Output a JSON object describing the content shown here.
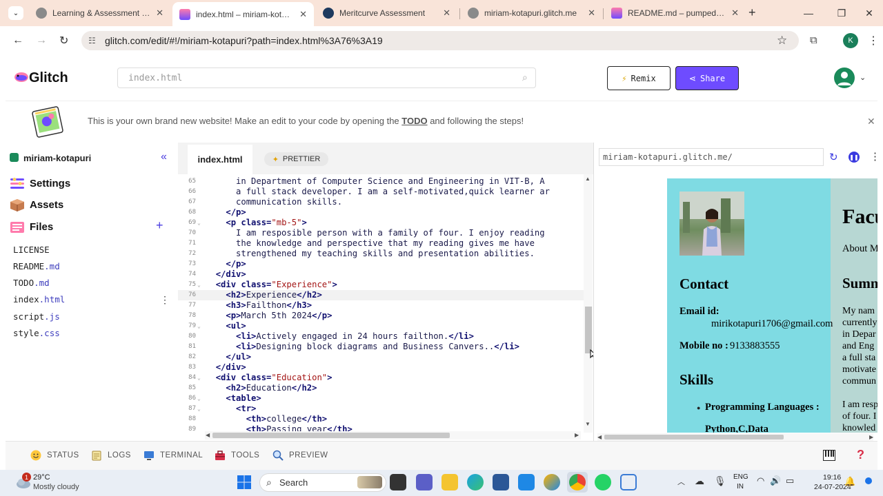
{
  "browser": {
    "tabs": [
      {
        "title": "Learning & Assessment Platform",
        "active": false
      },
      {
        "title": "index.html – miriam-kotapuri",
        "active": true
      },
      {
        "title": "Meritcurve Assessment",
        "active": false
      },
      {
        "title": "miriam-kotapuri.glitch.me",
        "active": false
      },
      {
        "title": "README.md – pumped-uneven",
        "active": false
      }
    ],
    "url": "glitch.com/edit/#!/miriam-kotapuri?path=index.html%3A76%3A19",
    "profile_initial": "K"
  },
  "glitch": {
    "logo": "Glitch",
    "search_placeholder": "index.html",
    "remix_label": "Remix",
    "share_label": "Share",
    "banner": {
      "before": "This is your own brand new website! Make an edit to your code by opening the ",
      "link": "TODO",
      "after": " and following the steps!"
    }
  },
  "sidebar": {
    "project_name": "miriam-kotapuri",
    "settings": "Settings",
    "assets": "Assets",
    "files_label": "Files",
    "files": [
      {
        "name": "LICENSE",
        "ext": ""
      },
      {
        "name": "README",
        "ext": ".md"
      },
      {
        "name": "TODO",
        "ext": ".md"
      },
      {
        "name": "index",
        "ext": ".html"
      },
      {
        "name": "script",
        "ext": ".js"
      },
      {
        "name": "style",
        "ext": ".css"
      }
    ]
  },
  "editor": {
    "active_file": "index.html",
    "prettier": "PRETTIER",
    "lines": [
      {
        "n": "65",
        "fold": "",
        "text": "      in Department of Computer Science and Engineering in VIT-B, A"
      },
      {
        "n": "66",
        "fold": "",
        "text": "      a full stack developer. I am a self-motivated,quick learner ar"
      },
      {
        "n": "67",
        "fold": "",
        "text": "      communication skills."
      },
      {
        "n": "68",
        "fold": "",
        "text": "    </p>"
      },
      {
        "n": "69",
        "fold": "⌄",
        "text": "    <p class=\"mb-5\">"
      },
      {
        "n": "70",
        "fold": "",
        "text": "      I am resposible person with a family of four. I enjoy reading"
      },
      {
        "n": "71",
        "fold": "",
        "text": "      the knowledge and perspective that my reading gives me have"
      },
      {
        "n": "72",
        "fold": "",
        "text": "      strengthened my teaching skills and presentation abilities."
      },
      {
        "n": "73",
        "fold": "",
        "text": "    </p>"
      },
      {
        "n": "74",
        "fold": "",
        "text": "  </div>"
      },
      {
        "n": "75",
        "fold": "⌄",
        "text": "  <div class=\"Experience\">"
      },
      {
        "n": "76",
        "fold": "",
        "text": "    <h2>Experience</h2>"
      },
      {
        "n": "77",
        "fold": "",
        "text": "    <h3>Failthon</h3>"
      },
      {
        "n": "78",
        "fold": "",
        "text": "    <p>March 5th 2024</p>"
      },
      {
        "n": "79",
        "fold": "⌄",
        "text": "    <ul>"
      },
      {
        "n": "80",
        "fold": "",
        "text": "      <li>Actively engaged in 24 hours failthon.</li>"
      },
      {
        "n": "81",
        "fold": "",
        "text": "      <li>Designing block diagrams and Business Canvers..</li>"
      },
      {
        "n": "82",
        "fold": "",
        "text": "    </ul>"
      },
      {
        "n": "83",
        "fold": "",
        "text": "  </div>"
      },
      {
        "n": "84",
        "fold": "⌄",
        "text": "  <div class=\"Education\">"
      },
      {
        "n": "85",
        "fold": "",
        "text": "    <h2>Education</h2>"
      },
      {
        "n": "86",
        "fold": "⌄",
        "text": "    <table>"
      },
      {
        "n": "87",
        "fold": "⌄",
        "text": "      <tr>"
      },
      {
        "n": "88",
        "fold": "",
        "text": "        <th>college</th>"
      },
      {
        "n": "89",
        "fold": "",
        "text": "        <th>Passing year</th>"
      },
      {
        "n": "90",
        "fold": "",
        "text": ""
      }
    ]
  },
  "preview": {
    "url": "miriam-kotapuri.glitch.me/",
    "contact_heading": "Contact",
    "email_label": "Email id:",
    "email_value": "mirikotapuri1706@gmail.com",
    "mobile_label": "Mobile no :",
    "mobile_value": "9133883555",
    "skills_heading": "Skills",
    "skills": [
      "Programming Languages :",
      "Python,C,Data"
    ],
    "right_title": "Facu",
    "right_about": "About M",
    "right_summary": "Summ",
    "right_para1": [
      "My nam",
      "currently",
      "in Depar",
      "and Eng",
      "a full sta",
      "motivate",
      "commun"
    ],
    "right_para2": [
      "I am resp",
      "of four. I",
      "knowled"
    ]
  },
  "bottombar": {
    "status": "STATUS",
    "logs": "LOGS",
    "terminal": "TERMINAL",
    "tools": "TOOLS",
    "preview": "PREVIEW"
  },
  "taskbar": {
    "weather_temp": "29°C",
    "weather_desc": "Mostly cloudy",
    "weather_badge": "1",
    "search": "Search",
    "lang1": "ENG",
    "lang2": "IN",
    "time": "19:16",
    "date": "24-07-2024"
  },
  "colors": {
    "accent": "#6e4cff",
    "preview_left": "#7fdbe3",
    "preview_right": "#b7d7d3"
  }
}
